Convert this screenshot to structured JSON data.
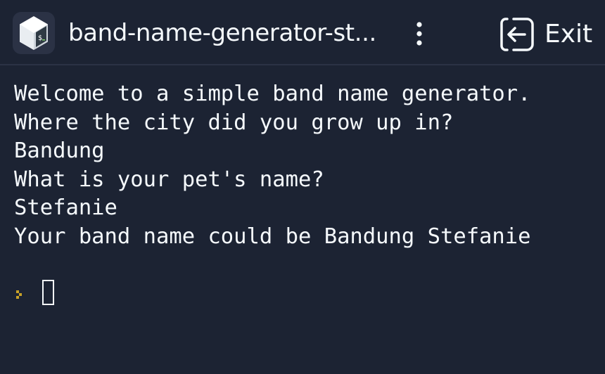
{
  "header": {
    "app_icon": "bash-terminal-icon",
    "title": "band-name-generator-st...",
    "menu_icon": "vertical-ellipsis-icon",
    "exit_icon": "exit-arrow-icon",
    "exit_label": "Exit"
  },
  "console": {
    "lines": [
      "Welcome to a simple band name generator.",
      "Where the city did you grow up in?",
      "Bandung",
      "What is your pet's name?",
      "Stefanie",
      "Your band name could be Bandung Stefanie"
    ],
    "prompt_icon": "prompt-chevron-icon"
  },
  "colors": {
    "background": "#1c2333",
    "text": "#f5f9fc",
    "prompt_accent": "#c9a227",
    "divider": "#2b3245"
  }
}
